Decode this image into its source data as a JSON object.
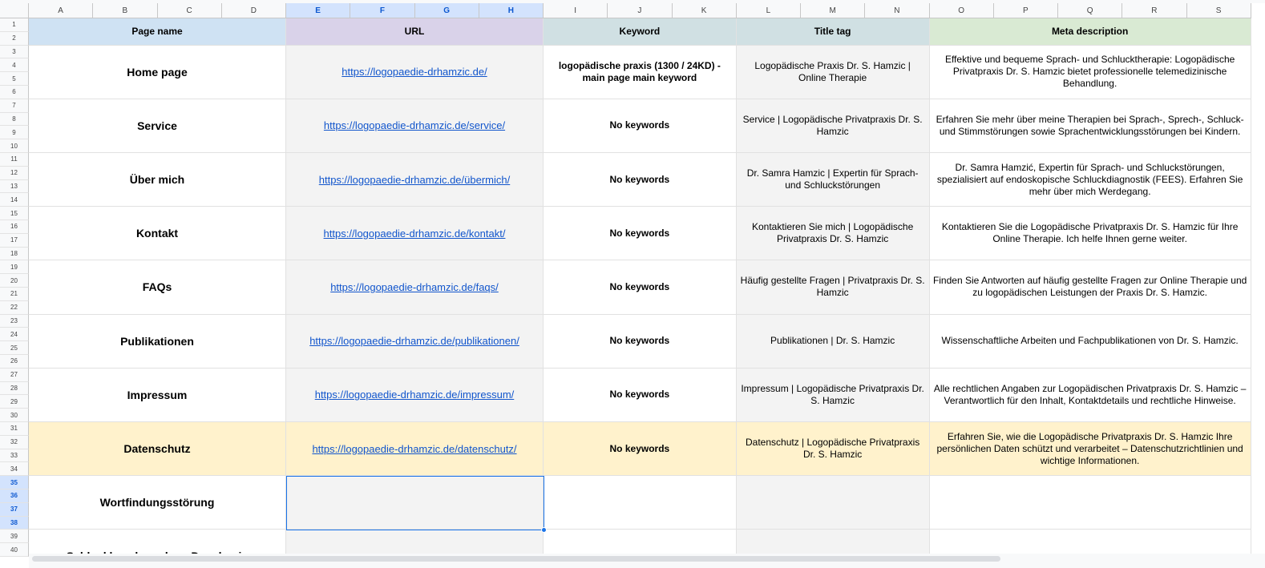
{
  "columns": [
    "A",
    "B",
    "C",
    "D",
    "E",
    "F",
    "G",
    "H",
    "I",
    "J",
    "K",
    "L",
    "M",
    "N",
    "O",
    "P",
    "Q",
    "R",
    "S"
  ],
  "selected_columns": [
    "E",
    "F",
    "G",
    "H"
  ],
  "rows": [
    "1",
    "2",
    "3",
    "4",
    "5",
    "6",
    "7",
    "8",
    "9",
    "10",
    "11",
    "12",
    "13",
    "14",
    "15",
    "16",
    "17",
    "18",
    "19",
    "20",
    "21",
    "22",
    "23",
    "24",
    "25",
    "26",
    "27",
    "28",
    "29",
    "30",
    "31",
    "32",
    "33",
    "34",
    "35",
    "36",
    "37",
    "38",
    "39",
    "40"
  ],
  "selected_rows": [
    "35",
    "36",
    "37",
    "38"
  ],
  "headers": {
    "page_name": "Page name",
    "url": "URL",
    "keyword": "Keyword",
    "title_tag": "Title tag",
    "meta_description": "Meta description"
  },
  "colors": {
    "hdr_page": "#cfe2f3",
    "hdr_url": "#d9d2e9",
    "hdr_kw": "#d0e0e3",
    "hdr_title": "#d0e0e3",
    "hdr_meta": "#d9ead3",
    "shade": "#f3f3f3",
    "highlight": "#fff2cc"
  },
  "entries": [
    {
      "page": "Home page",
      "url": "https://logopaedie-drhamzic.de/",
      "keyword": "logopädische praxis (1300 / 24KD) - main page main keyword",
      "title": "Logopädische Praxis Dr. S. Hamzic | Online Therapie",
      "meta": "Effektive und bequeme Sprach- und Schlucktherapie: Logopädische Privatpraxis Dr. S. Hamzic bietet professionelle telemedizinische Behandlung."
    },
    {
      "page": "Service",
      "url": "https://logopaedie-drhamzic.de/service/",
      "keyword": "No keywords",
      "title": "Service | Logopädische Privatpraxis Dr. S. Hamzic",
      "meta": "Erfahren Sie mehr über meine Therapien bei Sprach-, Sprech-, Schluck- und Stimmstörungen sowie Sprachentwicklungsstörungen bei Kindern."
    },
    {
      "page": "Über mich",
      "url": "https://logopaedie-drhamzic.de/übermich/",
      "keyword": "No keywords",
      "title": "Dr. Samra Hamzic | Expertin für Sprach- und Schluckstörungen",
      "meta": "Dr. Samra Hamzić, Expertin für Sprach- und Schluckstörungen, spezialisiert auf endoskopische Schluckdiagnostik (FEES). Erfahren Sie mehr über mich Werdegang."
    },
    {
      "page": "Kontakt",
      "url": "https://logopaedie-drhamzic.de/kontakt/",
      "keyword": "No keywords",
      "title": "Kontaktieren Sie mich | Logopädische Privatpraxis Dr. S. Hamzic",
      "meta": "Kontaktieren Sie die Logopädische Privatpraxis Dr. S. Hamzic für Ihre Online Therapie. Ich helfe Ihnen gerne weiter."
    },
    {
      "page": "FAQs",
      "url": "https://logopaedie-drhamzic.de/faqs/",
      "keyword": "No keywords",
      "title": "Häufig gestellte Fragen | Privatpraxis Dr. S. Hamzic",
      "meta": "Finden Sie Antworten auf häufig gestellte Fragen zur Online Therapie und zu logopädischen Leistungen der Praxis Dr. S. Hamzic."
    },
    {
      "page": "Publikationen",
      "url": "https://logopaedie-drhamzic.de/publikationen/",
      "keyword": "No keywords",
      "title": "Publikationen | Dr. S. Hamzic",
      "meta": "Wissenschaftliche Arbeiten und Fachpublikationen von Dr. S. Hamzic."
    },
    {
      "page": "Impressum",
      "url": "https://logopaedie-drhamzic.de/impressum/",
      "keyword": "No keywords",
      "title": "Impressum | Logopädische Privatpraxis Dr. S. Hamzic",
      "meta": "Alle rechtlichen Angaben zur Logopädischen Privatpraxis Dr. S. Hamzic – Verantwortlich für den Inhalt, Kontaktdetails und rechtliche Hinweise."
    },
    {
      "page": "Datenschutz",
      "url": "https://logopaedie-drhamzic.de/datenschutz/",
      "keyword": "No keywords",
      "title": "Datenschutz | Logopädische Privatpraxis Dr. S. Hamzic",
      "meta": "Erfahren Sie, wie die Logopädische Privatpraxis Dr. S. Hamzic Ihre persönlichen Daten schützt und verarbeitet – Datenschutzrichtlinien und wichtige Informationen.",
      "highlight": true
    },
    {
      "page": "Wortfindungsstörung",
      "url": "",
      "keyword": "",
      "title": "",
      "meta": ""
    },
    {
      "page": "Schluckbeschwerden - Dysphagie",
      "url": "",
      "keyword": "",
      "title": "",
      "meta": ""
    }
  ]
}
